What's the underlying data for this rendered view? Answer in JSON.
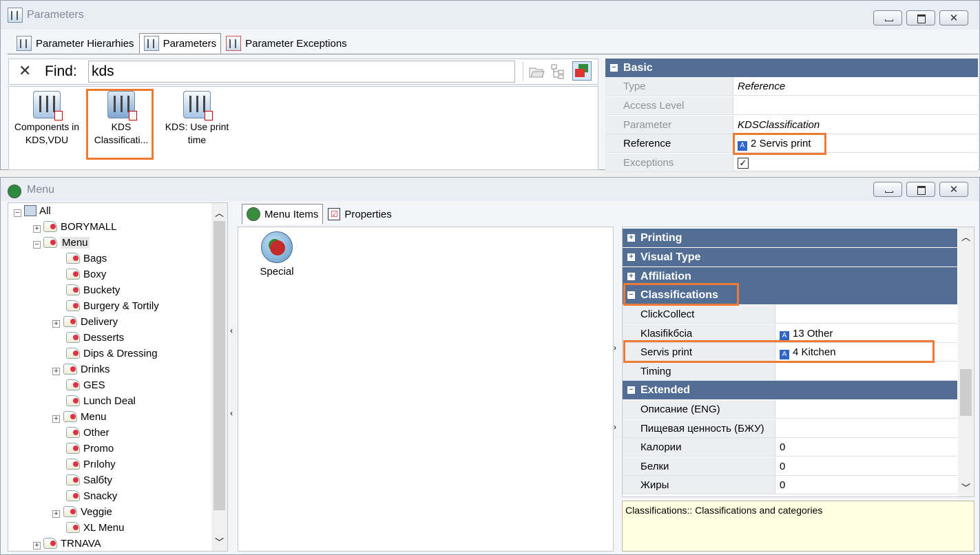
{
  "params_window": {
    "title": "Parameters",
    "tabs": [
      "Parameter Hierarhies",
      "Parameters",
      "Parameter Exceptions"
    ],
    "find_label": "Find:",
    "find_value": "kds",
    "items": [
      {
        "label_line1": "Components in",
        "label_line2": "KDS,VDU"
      },
      {
        "label_line1": "KDS",
        "label_line2": "Classificati..."
      },
      {
        "label_line1": "KDS: Use print",
        "label_line2": "time"
      }
    ],
    "grid": {
      "category": "Basic",
      "rows": [
        {
          "key": "Type",
          "value": "Reference"
        },
        {
          "key": "Access Level",
          "value": ""
        },
        {
          "key": "Parameter",
          "value": "KDSClassification"
        },
        {
          "key": "Reference",
          "value": "2 Servis print"
        },
        {
          "key": "Exceptions",
          "value": ""
        }
      ]
    }
  },
  "menu_window": {
    "title": "Menu",
    "tree": [
      {
        "label": "All"
      },
      {
        "label": "BORYMALL"
      },
      {
        "label": "Menu"
      },
      {
        "label": "Bags"
      },
      {
        "label": "Boxy"
      },
      {
        "label": "Buckety"
      },
      {
        "label": "Burgery & Tortily"
      },
      {
        "label": "Delivery"
      },
      {
        "label": "Desserts"
      },
      {
        "label": "Dips & Dressing"
      },
      {
        "label": "Drinks"
      },
      {
        "label": "GES"
      },
      {
        "label": "Lunch Deal"
      },
      {
        "label": "Menu"
      },
      {
        "label": "Other"
      },
      {
        "label": "Promo"
      },
      {
        "label": "Prılohy"
      },
      {
        "label": "Salбty"
      },
      {
        "label": "Snacky"
      },
      {
        "label": "Veggie"
      },
      {
        "label": "XL Menu"
      },
      {
        "label": "TRNAVA"
      }
    ],
    "tabs": [
      "Menu Items",
      "Properties"
    ],
    "menu_item": "Special",
    "grid": {
      "categories": [
        "Printing",
        "Visual Type",
        "Affiliation",
        "Classifications",
        "Extended"
      ],
      "classification_rows": [
        {
          "key": "ClickCollect",
          "value": ""
        },
        {
          "key": "Klasifikбcia",
          "value": "13 Other"
        },
        {
          "key": "Servis print",
          "value": "4 Kitchen"
        },
        {
          "key": "Timing",
          "value": ""
        }
      ],
      "extended_rows": [
        {
          "key": "Описание (ENG)",
          "value": ""
        },
        {
          "key": "Пищевая ценность (БЖУ)",
          "value": ""
        },
        {
          "key": "Калории",
          "value": "0"
        },
        {
          "key": "Белки",
          "value": "0"
        },
        {
          "key": "Жиры",
          "value": "0"
        }
      ]
    },
    "description": "Classifications:: Classifications and categories"
  },
  "badge_letter": "A",
  "colors": {
    "category_header": "#526e94",
    "highlight": "#ee7a33",
    "description_bg": "#ffffe1"
  }
}
